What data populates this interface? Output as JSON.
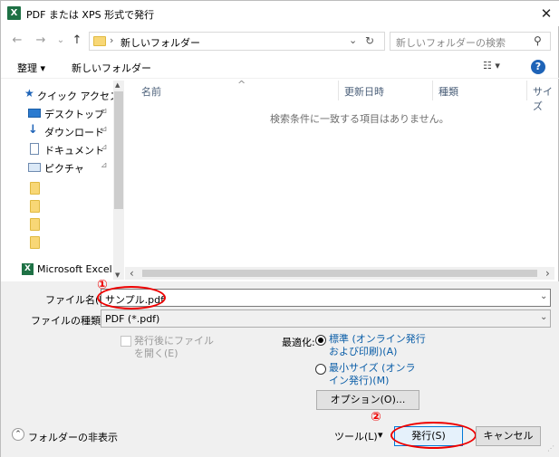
{
  "window": {
    "title": "PDF または XPS 形式で発行",
    "close_glyph": "✕",
    "app_icon_letter": "X"
  },
  "nav": {
    "back_glyph": "←",
    "forward_glyph": "→",
    "recent_glyph": "⌄",
    "up_glyph": "↑",
    "breadcrumb_sep": "›",
    "path": "新しいフォルダー",
    "refresh_glyph": "↻",
    "dropdown_glyph": "⌄",
    "search_placeholder": "新しいフォルダーの検索",
    "search_glyph": "⚲"
  },
  "toolbar": {
    "organize": "整理 ▾",
    "new_folder": "新しいフォルダー",
    "view_glyph": "☷ ▾",
    "help": "?"
  },
  "sidebar": {
    "items": [
      {
        "label": "クイック アクセス",
        "icon": "star-icon",
        "pinned": false
      },
      {
        "label": "デスクトップ",
        "icon": "desktop-icon",
        "pinned": true
      },
      {
        "label": "ダウンロード",
        "icon": "download-icon",
        "pinned": true
      },
      {
        "label": "ドキュメント",
        "icon": "document-icon",
        "pinned": true
      },
      {
        "label": "ピクチャ",
        "icon": "picture-icon",
        "pinned": true
      }
    ],
    "pin_glyph": "📌",
    "folder_count": 4,
    "excel_label": "Microsoft Excel",
    "scroll_up": "▲",
    "scroll_down": "▼"
  },
  "filelist": {
    "columns": [
      "名前",
      "更新日時",
      "種類",
      "サイズ"
    ],
    "sort_glyph": "^",
    "empty_message": "検索条件に一致する項目はありません。",
    "scroll_left": "‹",
    "scroll_right": "›"
  },
  "form": {
    "filename_label": "ファイル名(N):",
    "filename_value": "サンプル.pdf",
    "filetype_label": "ファイルの種類(T):",
    "filetype_value": "PDF (*.pdf)",
    "open_after_label": "発行後にファイルを開く(E)",
    "optimize_label": "最適化:",
    "opt_standard": "標準 (オンライン発行および印刷)(A)",
    "opt_minimum": "最小サイズ (オンライン発行)(M)",
    "options_button": "オプション(O)...",
    "tools_label": "ツール(L)",
    "tools_glyph": "▾",
    "publish_button": "発行(S)",
    "cancel_button": "キャンセル",
    "hide_folders": "フォルダーの非表示",
    "hide_glyph": "⌃"
  },
  "annotations": {
    "marker1": "①",
    "marker2": "②"
  },
  "colors": {
    "accent": "#1e63b7",
    "annotation": "#e00000",
    "excel": "#1e7145",
    "folder": "#f8d776"
  }
}
